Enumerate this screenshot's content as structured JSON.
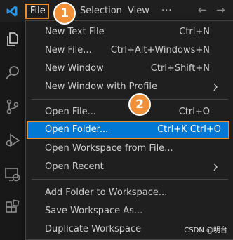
{
  "menubar": {
    "file": "File",
    "selection": "Selection",
    "view": "View",
    "more": "···",
    "back": "←",
    "forward": "→"
  },
  "annotations": [
    "1",
    "2"
  ],
  "menu": {
    "items": [
      {
        "label": "New Text File",
        "shortcut": "Ctrl+N"
      },
      {
        "label": "New File...",
        "shortcut": "Ctrl+Alt+Windows+N"
      },
      {
        "label": "New Window",
        "shortcut": "Ctrl+Shift+N"
      },
      {
        "label": "New Window with Profile",
        "shortcut": ""
      },
      {
        "label": "Open File...",
        "shortcut": "Ctrl+O"
      },
      {
        "label": "Open Folder...",
        "shortcut": "Ctrl+K Ctrl+O"
      },
      {
        "label": "Open Workspace from File...",
        "shortcut": ""
      },
      {
        "label": "Open Recent",
        "shortcut": ""
      },
      {
        "label": "Add Folder to Workspace...",
        "shortcut": ""
      },
      {
        "label": "Save Workspace As...",
        "shortcut": ""
      },
      {
        "label": "Duplicate Workspace",
        "shortcut": ""
      }
    ]
  },
  "activity_icons": [
    "explorer-icon",
    "search-icon",
    "source-control-icon",
    "run-debug-icon",
    "remote-explorer-icon",
    "extensions-icon"
  ],
  "watermark": "CSDN @明台",
  "colors": {
    "highlight_border": "#f28c28",
    "selected_bg": "#0078d4",
    "badge": "#f0913a"
  }
}
